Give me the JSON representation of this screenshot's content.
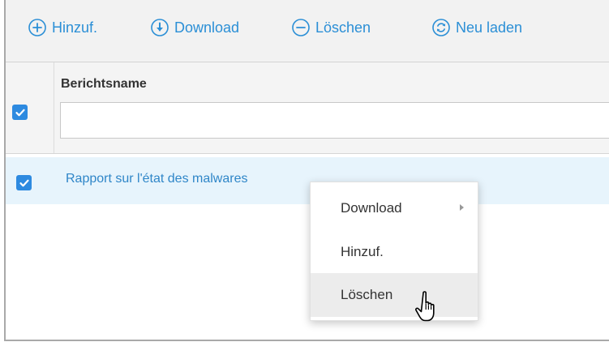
{
  "toolbar": {
    "add_label": "Hinzuf.",
    "add_icon": "plus-circle-icon",
    "download_label": "Download",
    "download_icon": "arrow-down-circle-icon",
    "delete_label": "Löschen",
    "delete_icon": "minus-circle-icon",
    "reload_label": "Neu laden",
    "reload_icon": "refresh-circle-icon"
  },
  "table": {
    "column_header": "Berichtsname",
    "select_all_checked": true,
    "filter_value": "",
    "rows": [
      {
        "name": "Rapport sur l'état des malwares",
        "checked": true
      }
    ]
  },
  "context_menu": {
    "items": [
      {
        "label": "Download",
        "has_submenu": true
      },
      {
        "label": "Hinzuf.",
        "has_submenu": false
      },
      {
        "label": "Löschen",
        "has_submenu": false,
        "hovered": true
      }
    ]
  },
  "colors": {
    "accent": "#2b8fd6",
    "checkbox": "#2d8ae0",
    "row_selected": "#e7f4fc",
    "toolbar_bg": "#f2f2f2"
  }
}
